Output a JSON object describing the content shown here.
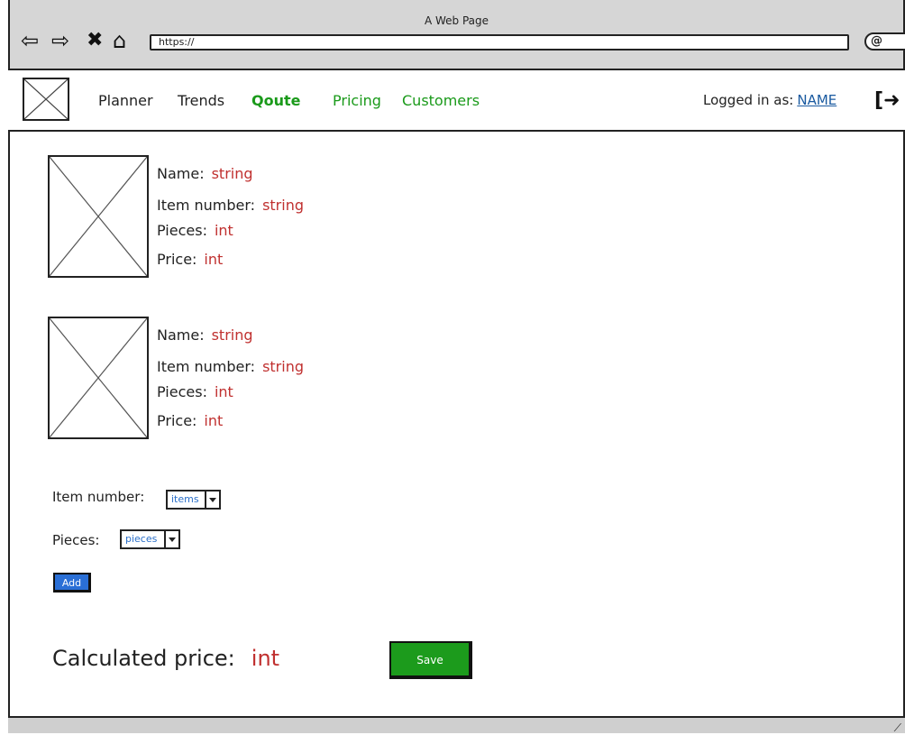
{
  "window": {
    "title": "A Web Page",
    "url": "https://"
  },
  "chrome_icons": [
    "back-arrow-icon",
    "forward-arrow-icon",
    "close-icon",
    "home-icon",
    "search-icon"
  ],
  "nav": {
    "items": [
      "Planner",
      "Trends",
      "Qoute",
      "Pricing",
      "Customers"
    ],
    "active": "Qoute",
    "logged_in_label": "Logged in as:",
    "user_name": "NAME"
  },
  "items": [
    {
      "name_label": "Name:",
      "name_value": "string",
      "item_number_label": "Item number:",
      "item_number_value": "string",
      "pieces_label": "Pieces:",
      "pieces_value": "int",
      "price_label": "Price:",
      "price_value": "int"
    },
    {
      "name_label": "Name:",
      "name_value": "string",
      "item_number_label": "Item number:",
      "item_number_value": "string",
      "pieces_label": "Pieces:",
      "pieces_value": "int",
      "price_label": "Price:",
      "price_value": "int"
    }
  ],
  "form": {
    "item_number_label": "Item number:",
    "item_number_selected": "items",
    "pieces_label": "Pieces:",
    "pieces_selected": "pieces",
    "add_label": "Add"
  },
  "summary": {
    "calculated_price_label": "Calculated price:",
    "calculated_price_value": "int",
    "save_label": "Save"
  },
  "colors": {
    "accent_green": "#1c9b1c",
    "value_red": "#c0302f",
    "link_blue": "#1a5aa0",
    "button_blue": "#2a6fd6"
  }
}
